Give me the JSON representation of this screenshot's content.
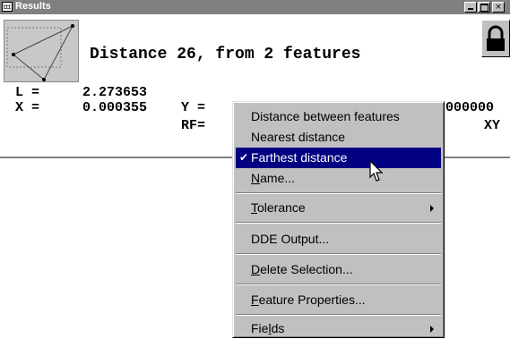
{
  "window": {
    "title": "Results",
    "headline": "Distance 26, from 2 features",
    "rows": {
      "l_label": "L =",
      "l_value": "2.273653",
      "x_label": "X =",
      "x_value": "0.000355",
      "y_label": "Y =",
      "y_value_clipped": "000000",
      "rf_label": "RF=",
      "xy_label": "XY"
    },
    "buttons": {
      "close": "×"
    }
  },
  "menu": {
    "items": [
      {
        "label": "Distance between features",
        "accel": ""
      },
      {
        "label": "Nearest distance",
        "accel": ""
      },
      {
        "label": "Farthest distance",
        "accel": "",
        "checked": true,
        "selected": true
      },
      {
        "label": "Name...",
        "accel": "N"
      },
      {
        "label": "Tolerance",
        "accel": "T",
        "submenu": true
      },
      {
        "label": "DDE Output...",
        "accel": ""
      },
      {
        "label": "Delete Selection...",
        "accel": "D"
      },
      {
        "label": "Feature Properties...",
        "accel": "F"
      },
      {
        "label": "Fields",
        "accel": "l",
        "submenu": true
      }
    ],
    "check_mark": "✔"
  }
}
